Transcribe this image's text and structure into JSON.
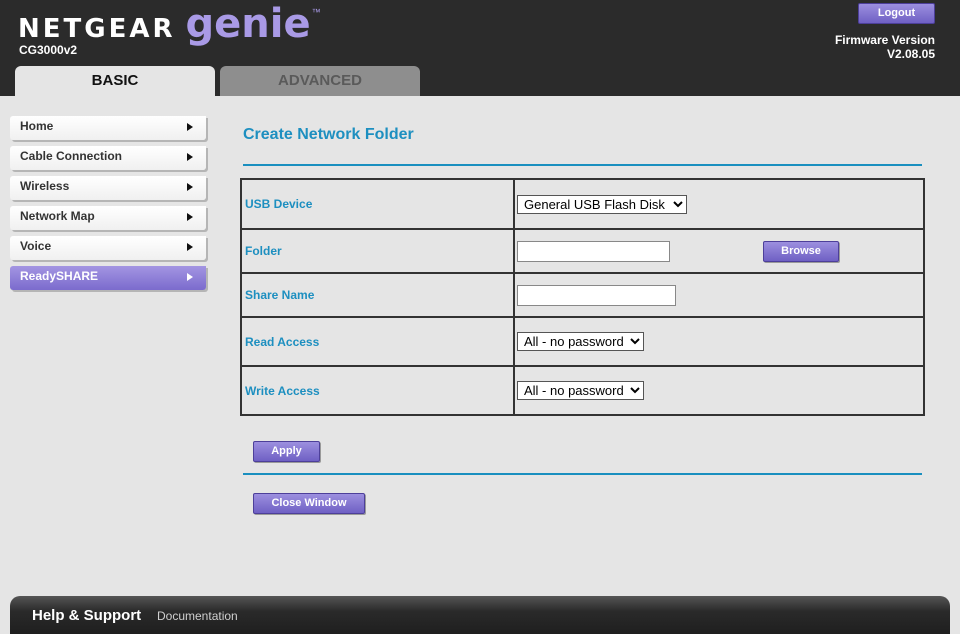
{
  "header": {
    "brand": "NETGEAR",
    "product": "genie",
    "trademark": "™",
    "model": "CG3000v2",
    "logout_label": "Logout",
    "firmware_label": "Firmware Version",
    "firmware_value": "V2.08.05"
  },
  "tabs": [
    {
      "label": "BASIC",
      "active": true
    },
    {
      "label": "ADVANCED",
      "active": false
    }
  ],
  "sidebar": {
    "items": [
      {
        "label": "Home"
      },
      {
        "label": "Cable Connection"
      },
      {
        "label": "Wireless"
      },
      {
        "label": "Network Map"
      },
      {
        "label": "Voice"
      },
      {
        "label": "ReadySHARE",
        "active": true
      }
    ]
  },
  "main": {
    "title": "Create Network Folder",
    "fields": {
      "usb_device": {
        "label": "USB Device",
        "selected": "General USB Flash Disk"
      },
      "folder": {
        "label": "Folder",
        "value": "",
        "browse_label": "Browse"
      },
      "share_name": {
        "label": "Share Name",
        "value": ""
      },
      "read_access": {
        "label": "Read Access",
        "selected": "All - no password"
      },
      "write_access": {
        "label": "Write Access",
        "selected": "All - no password"
      }
    },
    "apply_label": "Apply",
    "close_label": "Close Window"
  },
  "footer": {
    "help_label": "Help & Support",
    "doc_label": "Documentation"
  },
  "colors": {
    "accent_purple": "#7b6bcd",
    "title_blue": "#1d8fc0",
    "header_bg": "#2b2b2b"
  }
}
